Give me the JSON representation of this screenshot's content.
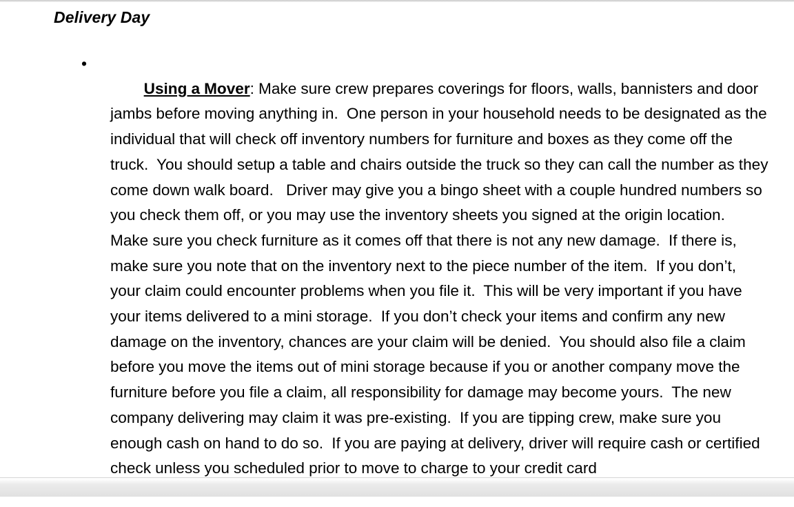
{
  "document": {
    "heading": "Delivery Day",
    "bullets": [
      {
        "marker": "•",
        "lead_label": "Using a Mover",
        "separator": ": ",
        "body": "Make sure crew prepares coverings for floors, walls, bannisters and door jambs before moving anything in.  One person in your household needs to be designated as the individual that will check off inventory numbers for furniture and boxes as they come off the truck.  You should setup a table and chairs outside the truck so they can call the number as they come down walk board.   Driver may give you a bingo sheet with a couple hundred numbers so you check them off, or you may use the inventory sheets you signed at the origin location.  Make sure you check furniture as it comes off that there is not any new damage.  If there is, make sure you note that on the inventory next to the piece number of the item.  If you don’t, your claim could encounter problems when you file it.  This will be very important if you have your items delivered to a mini storage.  If you don’t check your items and confirm any new damage on the inventory, chances are your claim will be denied.  You should also file a claim before you move the items out of mini storage because if you or another company move the furniture before you file a claim, all responsibility for damage may become yours.  The new company delivering may claim it was pre-existing.  If you are tipping crew, make sure you enough cash on hand to do so.  If you are paying at delivery, driver will require cash or certified check unless you scheduled prior to move to charge to your credit card"
      }
    ]
  },
  "colors": {
    "page_background": "#ffffff",
    "text": "#000000",
    "top_rule": "#c9c9c9",
    "bottom_band": "#dedede"
  }
}
